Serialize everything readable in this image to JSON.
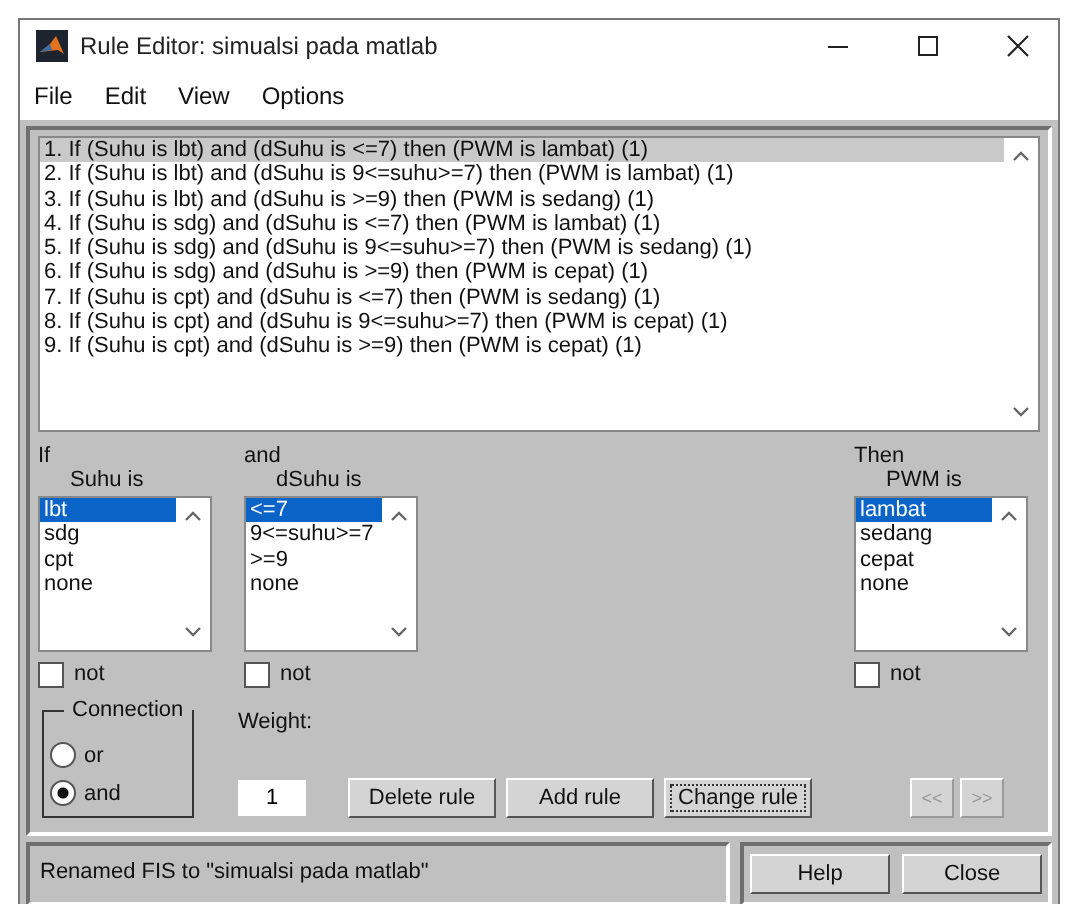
{
  "window": {
    "title": "Rule Editor: simualsi pada matlab"
  },
  "menu": [
    "File",
    "Edit",
    "View",
    "Options"
  ],
  "rules": [
    {
      "text": "1. If (Suhu is lbt) and (dSuhu is <=7) then (PWM is lambat) (1)",
      "selected": true
    },
    {
      "text": "2. If (Suhu is lbt) and (dSuhu is 9<=suhu>=7) then (PWM is lambat) (1)",
      "selected": false
    },
    {
      "text": "3. If (Suhu is lbt) and (dSuhu is >=9) then (PWM is sedang) (1)",
      "selected": false
    },
    {
      "text": "4. If (Suhu is sdg) and (dSuhu is <=7) then (PWM is lambat) (1)",
      "selected": false
    },
    {
      "text": "5. If (Suhu is sdg) and (dSuhu is 9<=suhu>=7) then (PWM is sedang) (1)",
      "selected": false
    },
    {
      "text": "6. If (Suhu is sdg) and (dSuhu is >=9) then (PWM is cepat) (1)",
      "selected": false
    },
    {
      "text": "7. If (Suhu is cpt) and (dSuhu is <=7) then (PWM is sedang) (1)",
      "selected": false
    },
    {
      "text": "8. If (Suhu is cpt) and (dSuhu is 9<=suhu>=7) then (PWM is cepat) (1)",
      "selected": false
    },
    {
      "text": "9. If (Suhu is cpt) and (dSuhu is >=9) then (PWM is cepat) (1)",
      "selected": false
    }
  ],
  "variables": [
    {
      "kind": "input",
      "heading": "If",
      "label": "Suhu is",
      "not": false,
      "not_label": "not",
      "items": [
        {
          "text": "lbt",
          "selected": true
        },
        {
          "text": "sdg",
          "selected": false
        },
        {
          "text": "cpt",
          "selected": false
        },
        {
          "text": "none",
          "selected": false
        }
      ]
    },
    {
      "kind": "input",
      "heading": "and",
      "label": "dSuhu is",
      "not": false,
      "not_label": "not",
      "items": [
        {
          "text": "<=7",
          "selected": true
        },
        {
          "text": "9<=suhu>=7",
          "selected": false
        },
        {
          "text": ">=9",
          "selected": false
        },
        {
          "text": "none",
          "selected": false
        }
      ]
    },
    {
      "kind": "output",
      "heading": "Then",
      "label": "PWM is",
      "not": false,
      "not_label": "not",
      "items": [
        {
          "text": "lambat",
          "selected": true
        },
        {
          "text": "sedang",
          "selected": false
        },
        {
          "text": "cepat",
          "selected": false
        },
        {
          "text": "none",
          "selected": false
        }
      ]
    }
  ],
  "connection": {
    "title": "Connection",
    "options": [
      {
        "label": "or",
        "selected": false
      },
      {
        "label": "and",
        "selected": true
      }
    ]
  },
  "weight": {
    "label": "Weight:",
    "value": "1"
  },
  "rule_buttons": [
    {
      "label": "Delete rule",
      "focused": false
    },
    {
      "label": "Add rule",
      "focused": false
    },
    {
      "label": "Change rule",
      "focused": true
    }
  ],
  "nav_buttons": [
    {
      "label": "<<",
      "disabled": true
    },
    {
      "label": ">>",
      "disabled": true
    }
  ],
  "status_bar": "Renamed FIS to \"simualsi pada matlab\"",
  "footer_buttons": [
    "Help",
    "Close"
  ]
}
